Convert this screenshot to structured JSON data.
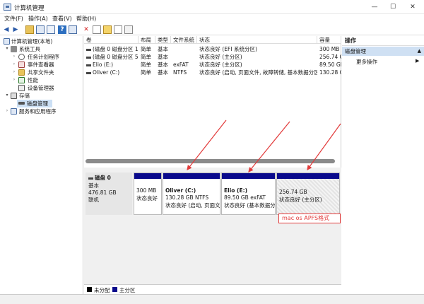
{
  "window": {
    "title": "计算机管理",
    "min_glyph": "—",
    "max_glyph": "☐",
    "close_glyph": "✕"
  },
  "menu": [
    "文件(F)",
    "操作(A)",
    "查看(V)",
    "帮助(H)"
  ],
  "tree": {
    "root": "计算机管理(本地)",
    "system_tools": "系统工具",
    "task_scheduler": "任务计划程序",
    "event_viewer": "事件查看器",
    "shared_folders": "共享文件夹",
    "performance": "性能",
    "device_manager": "设备管理器",
    "storage": "存储",
    "disk_management": "磁盘管理",
    "services_apps": "服务和应用程序"
  },
  "table": {
    "columns": [
      "卷",
      "布局",
      "类型",
      "文件系统",
      "状态",
      "容量"
    ],
    "rows": [
      {
        "vol": "(磁盘 0 磁盘分区 1)",
        "layout": "简单",
        "type": "基本",
        "fs": "",
        "status": "状态良好 (EFI 系统分区)",
        "cap": "300 MB"
      },
      {
        "vol": "(磁盘 0 磁盘分区 5)",
        "layout": "简单",
        "type": "基本",
        "fs": "",
        "status": "状态良好 (主分区)",
        "cap": "256.74 G"
      },
      {
        "vol": "Elio (E:)",
        "layout": "简单",
        "type": "基本",
        "fs": "exFAT",
        "status": "状态良好 (主分区)",
        "cap": "89.50 GE"
      },
      {
        "vol": "Oliver (C:)",
        "layout": "简单",
        "type": "基本",
        "fs": "NTFS",
        "status": "状态良好 (启动, 页面文件, 故障转储, 基本数据分区)",
        "cap": "130.28 G"
      }
    ]
  },
  "disk": {
    "name": "磁盘 0",
    "kind": "基本",
    "size": "476.81 GB",
    "state": "联机"
  },
  "partitions": [
    {
      "title": "",
      "line1": "300 MB",
      "line2": "状态良好"
    },
    {
      "title": "Oliver (C:)",
      "line1": "130.28 GB NTFS",
      "line2": "状态良好 (启动, 页面文"
    },
    {
      "title": "Elio (E:)",
      "line1": "89.50 GB exFAT",
      "line2": "状态良好 (基本数据分"
    },
    {
      "title": "",
      "line1": "256.74 GB",
      "line2": "状态良好 (主分区)"
    }
  ],
  "annotation": "mac os APFS格式",
  "actions": {
    "header": "操作",
    "section": "磁盘管理",
    "more": "更多操作"
  },
  "legend": [
    {
      "label": "未分配",
      "color": "#000000"
    },
    {
      "label": "主分区",
      "color": "#0a0a8c"
    }
  ],
  "colors": {
    "partition_bar": "#0a0a8c",
    "annotation": "#e23a3a",
    "selected": "#cce0f5"
  }
}
